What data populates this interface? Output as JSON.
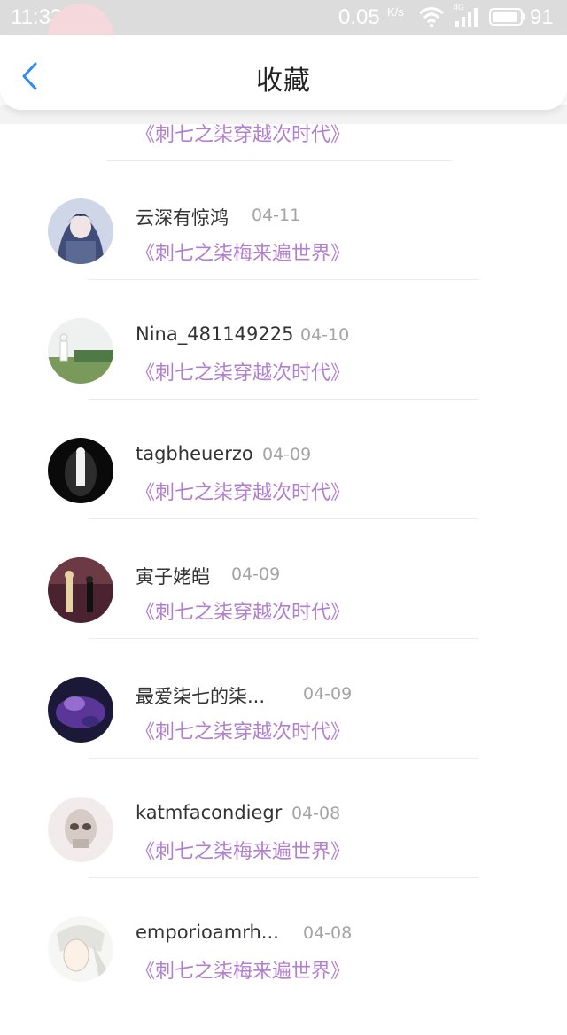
{
  "status_bar": {
    "time": "11:33",
    "net_speed": "0.05",
    "net_unit": "K/s",
    "network": "4G",
    "battery": "91",
    "battery_level": 0.91
  },
  "header": {
    "title": "收藏",
    "back_icon": "chevron-left-icon",
    "accent": "#2f8bf3"
  },
  "colors": {
    "book_title": "#b27fd0",
    "date": "#a4a4a4",
    "name": "#333333"
  },
  "rows": [
    {
      "name": "",
      "date": "",
      "book": "《刺七之柒穿越次时代》"
    },
    {
      "name": "云深有惊鸿",
      "date": "04-11",
      "book": "《刺七之柒梅来遍世界》"
    },
    {
      "name": "Nina_481149225",
      "date": "04-10",
      "book": "《刺七之柒穿越次时代》"
    },
    {
      "name": "tagbheuerzo",
      "date": "04-09",
      "book": "《刺七之柒穿越次时代》"
    },
    {
      "name": "寅子姥皑",
      "date": "04-09",
      "book": "《刺七之柒穿越次时代》"
    },
    {
      "name": "最爱柒七的柒...",
      "date": "04-09",
      "book": "《刺七之柒穿越次时代》"
    },
    {
      "name": "katmfacondiegr",
      "date": "04-08",
      "book": "《刺七之柒梅来遍世界》"
    },
    {
      "name": "emporioamrh...",
      "date": "04-08",
      "book": "《刺七之柒梅来遍世界》"
    }
  ]
}
